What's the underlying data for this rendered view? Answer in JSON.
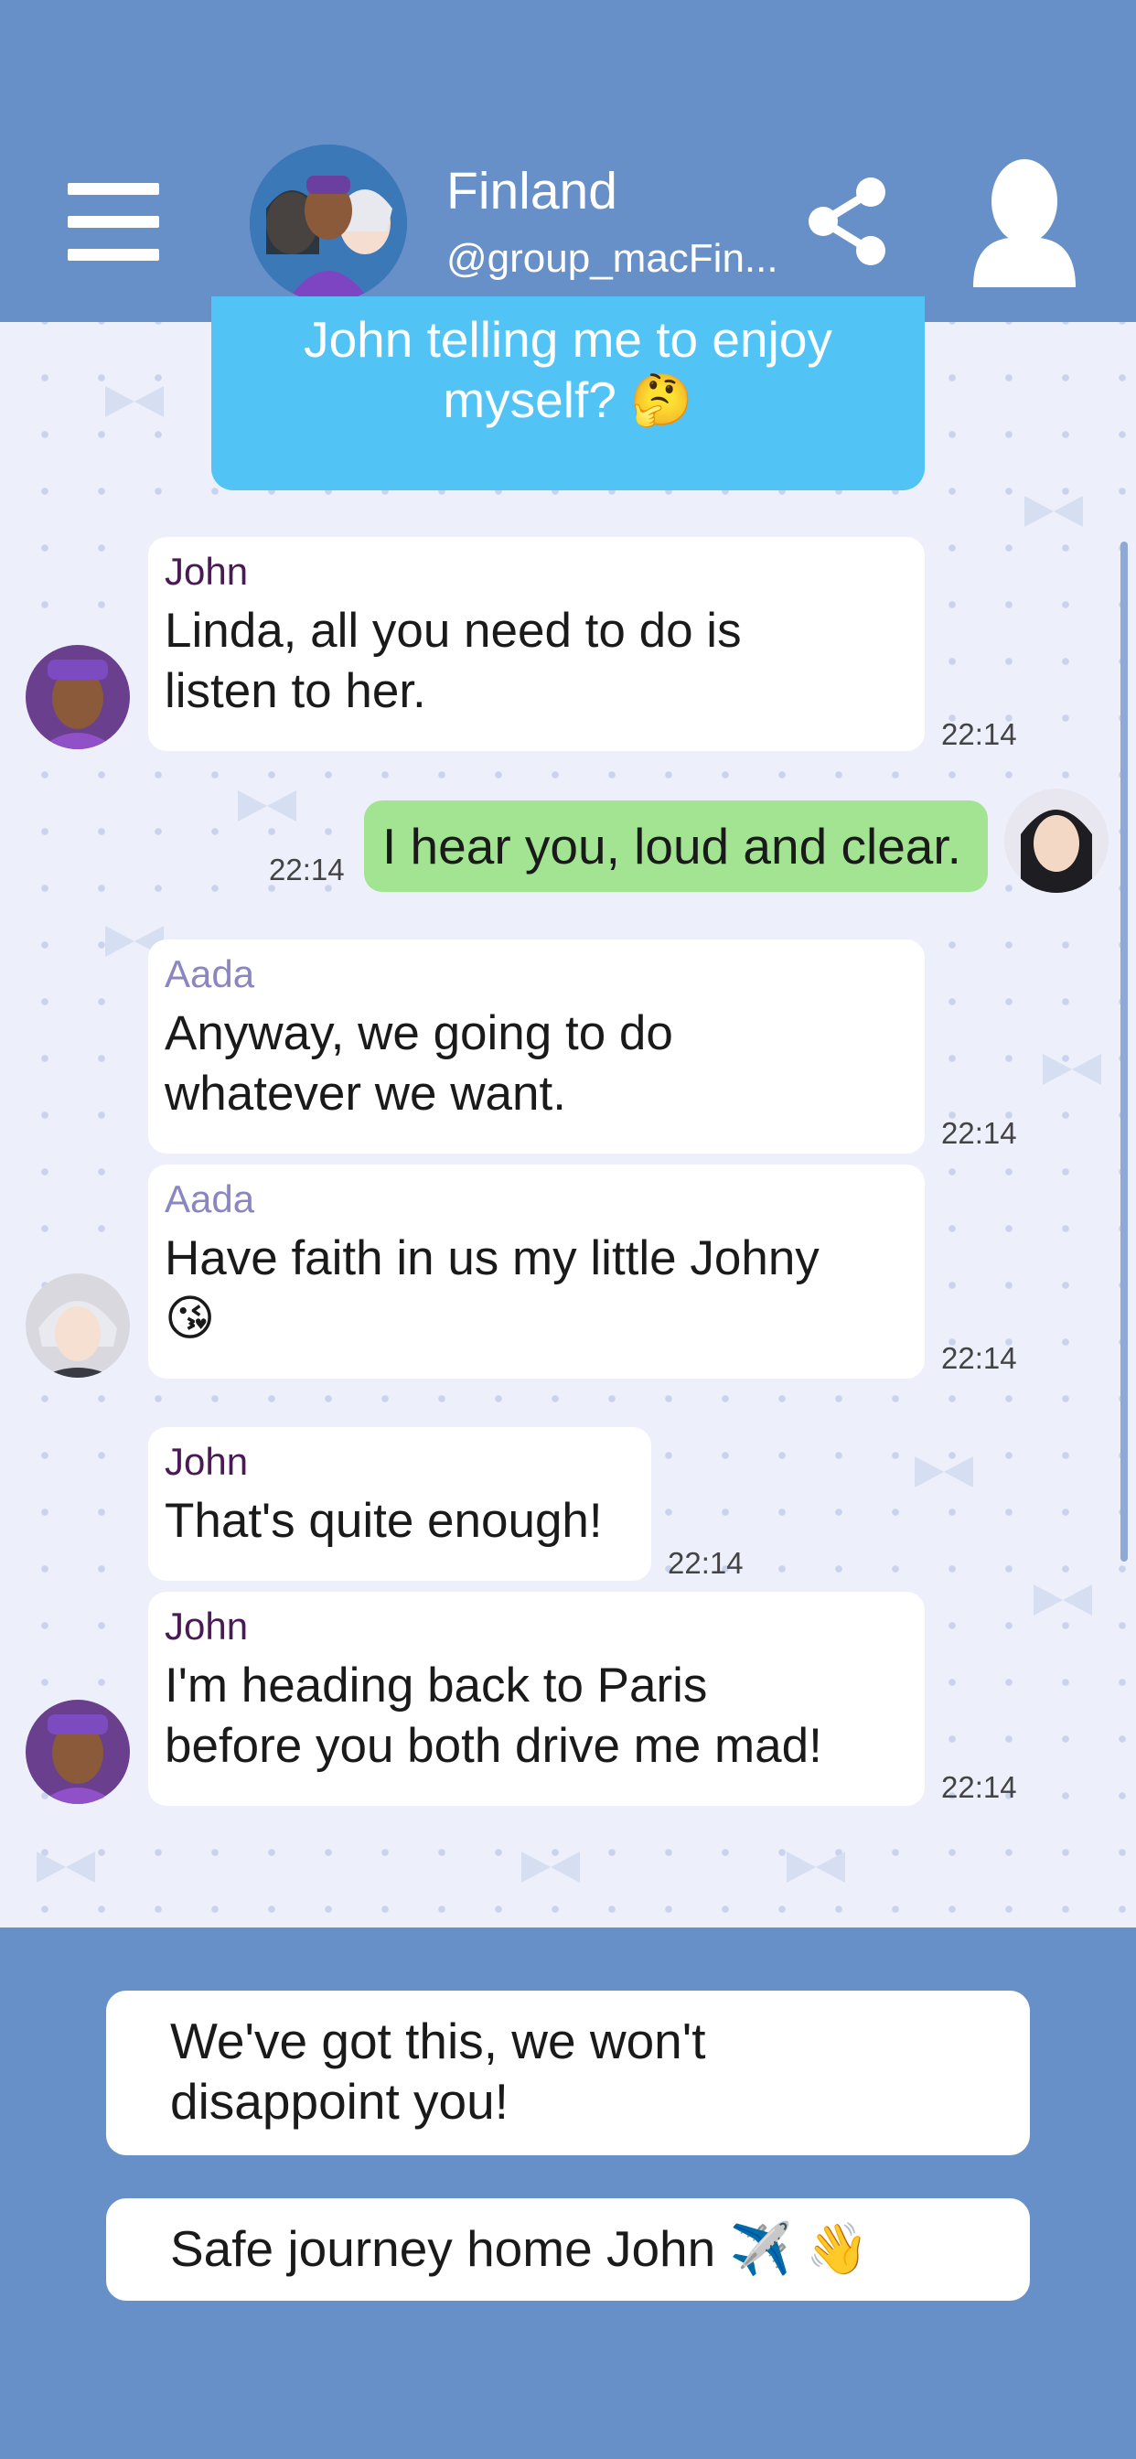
{
  "header": {
    "title": "Finland",
    "subtitle": "@group_macFin..."
  },
  "chat": {
    "system_message": "John telling me to enjoy myself? 🤔",
    "messages": [
      {
        "sender": "John",
        "text_line1": "Linda, all you need to do is",
        "text_line2": "listen to her.",
        "time": "22:14"
      },
      {
        "text": "I hear you, loud and clear.",
        "time": "22:14"
      },
      {
        "sender": "Aada",
        "text_line1": "Anyway, we going to do",
        "text_line2": "whatever we want.",
        "time": "22:14"
      },
      {
        "sender": "Aada",
        "text_line1": "Have faith in us my little Johny",
        "text_line2": "😘",
        "time": "22:14"
      },
      {
        "sender": "John",
        "text": "That's quite enough!",
        "time": "22:14"
      },
      {
        "sender": "John",
        "text_line1": "I'm heading back to Paris",
        "text_line2": "before you both drive me mad!",
        "time": "22:14"
      }
    ]
  },
  "choices": [
    {
      "line1": "We've got this, we won't",
      "line2": "disappoint you!"
    },
    {
      "text": "Safe journey home John ✈️ 👋"
    }
  ]
}
